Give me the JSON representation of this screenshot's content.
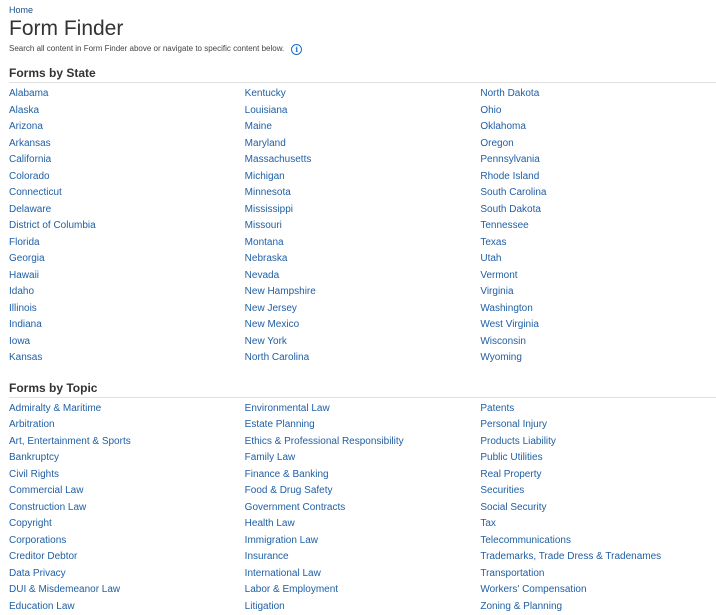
{
  "breadcrumb": {
    "home": "Home"
  },
  "page": {
    "title": "Form Finder",
    "subtitle": "Search all content in Form Finder above or navigate to specific content below."
  },
  "states": {
    "heading": "Forms by State",
    "columns": [
      [
        "Alabama",
        "Alaska",
        "Arizona",
        "Arkansas",
        "California",
        "Colorado",
        "Connecticut",
        "Delaware",
        "District of Columbia",
        "Florida",
        "Georgia",
        "Hawaii",
        "Idaho",
        "Illinois",
        "Indiana",
        "Iowa",
        "Kansas"
      ],
      [
        "Kentucky",
        "Louisiana",
        "Maine",
        "Maryland",
        "Massachusetts",
        "Michigan",
        "Minnesota",
        "Mississippi",
        "Missouri",
        "Montana",
        "Nebraska",
        "Nevada",
        "New Hampshire",
        "New Jersey",
        "New Mexico",
        "New York",
        "North Carolina"
      ],
      [
        "North Dakota",
        "Ohio",
        "Oklahoma",
        "Oregon",
        "Pennsylvania",
        "Rhode Island",
        "South Carolina",
        "South Dakota",
        "Tennessee",
        "Texas",
        "Utah",
        "Vermont",
        "Virginia",
        "Washington",
        "West Virginia",
        "Wisconsin",
        "Wyoming"
      ]
    ]
  },
  "topics": {
    "heading": "Forms by Topic",
    "columns": [
      [
        "Admiralty & Maritime",
        "Arbitration",
        "Art, Entertainment & Sports",
        "Bankruptcy",
        "Civil Rights",
        "Commercial Law",
        "Construction Law",
        "Copyright",
        "Corporations",
        "Creditor Debtor",
        "Data Privacy",
        "DUI & Misdemeanor Law",
        "Education Law"
      ],
      [
        "Environmental Law",
        "Estate Planning",
        "Ethics & Professional Responsibility",
        "Family Law",
        "Finance & Banking",
        "Food & Drug Safety",
        "Government Contracts",
        "Health Law",
        "Immigration Law",
        "Insurance",
        "International Law",
        "Labor & Employment",
        "Litigation"
      ],
      [
        "Patents",
        "Personal Injury",
        "Products Liability",
        "Public Utilities",
        "Real Property",
        "Securities",
        "Social Security",
        "Tax",
        "Telecommunications",
        "Trademarks, Trade Dress & Tradenames",
        "Transportation",
        "Workers' Compensation",
        "Zoning & Planning"
      ]
    ]
  },
  "colors": {
    "link": "#1f5fa5",
    "text": "#333333",
    "divider": "#e1e1e1"
  },
  "icons": {
    "info": "info-circle-icon"
  }
}
